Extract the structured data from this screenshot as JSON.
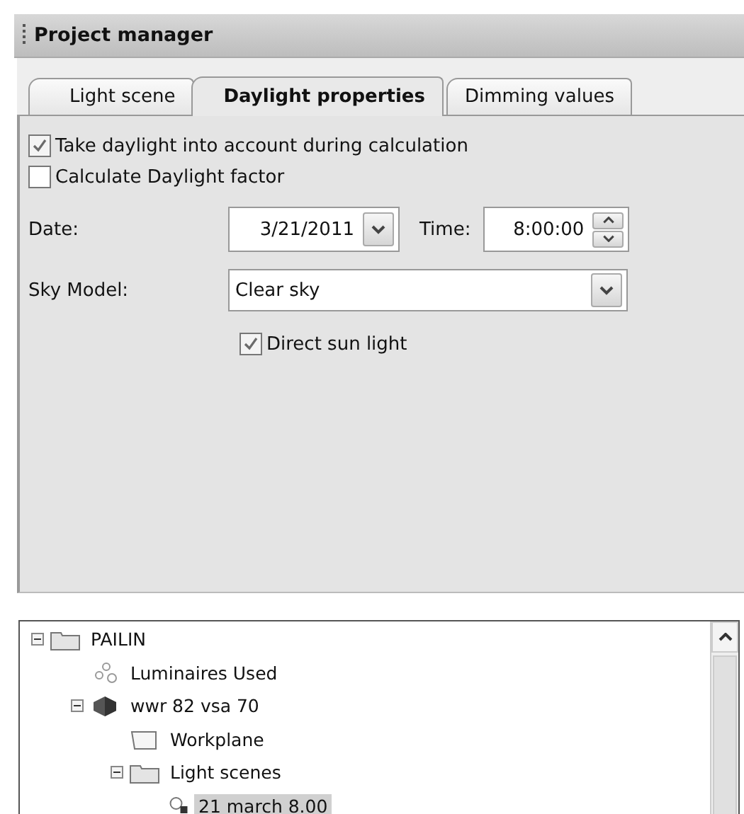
{
  "panel": {
    "title": "Project manager"
  },
  "tabs": [
    {
      "label": "Light scene",
      "selected": false
    },
    {
      "label": "Daylight properties",
      "selected": true
    },
    {
      "label": "Dimming values",
      "selected": false
    }
  ],
  "options": [
    {
      "label": "Take daylight into account during calculation",
      "checked": true
    },
    {
      "label": "Calculate Daylight factor",
      "checked": false
    }
  ],
  "date": {
    "label": "Date:",
    "value": "3/21/2011"
  },
  "time": {
    "label": "Time:",
    "value": "8:00:00"
  },
  "sky_model": {
    "label": "Sky Model:",
    "value": "Clear sky"
  },
  "direct_sun": {
    "label": "Direct sun light",
    "checked": true
  },
  "tree": [
    {
      "label": "PAILIN",
      "kind": "folder",
      "expanded": true,
      "selected": false,
      "children": [
        {
          "label": "Luminaires Used",
          "kind": "luminaires",
          "selected": false
        },
        {
          "label": "wwr 82 vsa 70",
          "kind": "object",
          "expanded": true,
          "selected": false,
          "children": [
            {
              "label": "Workplane",
              "kind": "workplane",
              "selected": false
            },
            {
              "label": "Light scenes",
              "kind": "folder",
              "expanded": true,
              "selected": false,
              "children": [
                {
                  "label": "21 march 8.00",
                  "kind": "scene",
                  "selected": true
                }
              ]
            }
          ]
        }
      ]
    }
  ]
}
